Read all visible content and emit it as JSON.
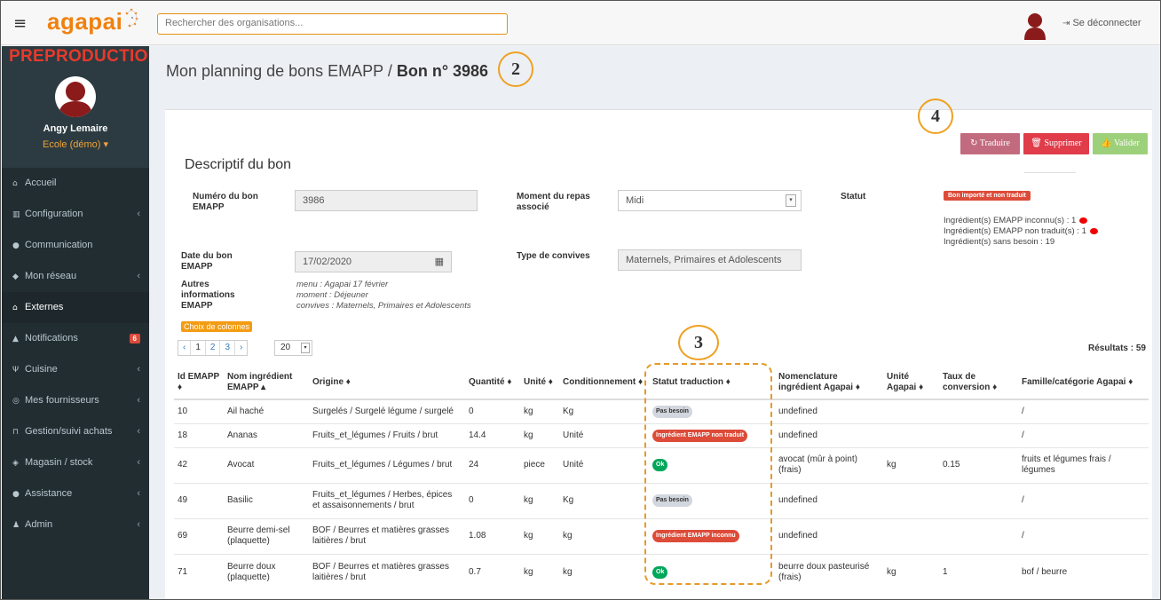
{
  "topbar": {
    "menu_icon": "hamburger-icon",
    "logo": "agapai",
    "search_placeholder": "Rechercher des organisations...",
    "logout_label": "Se déconnecter"
  },
  "sidebar": {
    "env_label": "PREPRODUCTION",
    "user_name": "Angy Lemaire",
    "user_org": "Ecole (démo) ▾",
    "items": [
      {
        "icon": "home-icon",
        "glyph": "⌂",
        "label": "Accueil",
        "arrow": ""
      },
      {
        "icon": "bank-icon",
        "glyph": "▥",
        "label": "Configuration",
        "arrow": "‹"
      },
      {
        "icon": "comments-icon",
        "glyph": "●",
        "label": "Communication",
        "arrow": ""
      },
      {
        "icon": "users-icon",
        "glyph": "◆",
        "label": "Mon réseau",
        "arrow": "‹"
      },
      {
        "icon": "home-icon",
        "glyph": "⌂",
        "label": "Externes",
        "arrow": ""
      },
      {
        "icon": "bell-icon",
        "glyph": "▲",
        "label": "Notifications",
        "arrow": "",
        "badge": "6"
      },
      {
        "icon": "cutlery-icon",
        "glyph": "Ψ",
        "label": "Cuisine",
        "arrow": "‹"
      },
      {
        "icon": "handshake-icon",
        "glyph": "◎",
        "label": "Mes fournisseurs",
        "arrow": "‹"
      },
      {
        "icon": "cart-icon",
        "glyph": "⊓",
        "label": "Gestion/suivi achats",
        "arrow": "‹"
      },
      {
        "icon": "cubes-icon",
        "glyph": "◈",
        "label": "Magasin / stock",
        "arrow": "‹"
      },
      {
        "icon": "info-icon",
        "glyph": "●",
        "label": "Assistance",
        "arrow": "‹"
      },
      {
        "icon": "user-plus-icon",
        "glyph": "♟",
        "label": "Admin",
        "arrow": "‹"
      }
    ]
  },
  "header": {
    "title_prefix": "Mon planning de bons EMAPP / ",
    "title_bold": "Bon n° 3986"
  },
  "markers": {
    "m2": "2",
    "m3": "3",
    "m4": "4"
  },
  "actions": {
    "translate": "↻ Traduire",
    "delete": "🗑 Supprimer",
    "validate": "👍 Valider"
  },
  "form": {
    "section_title": "Descriptif du bon",
    "numero_label_1": "Numéro du bon",
    "numero_label_2": "EMAPP",
    "numero_value": "3986",
    "moment_label_1": "Moment du repas",
    "moment_label_2": "associé",
    "moment_value": "Midi",
    "statut_label": "Statut",
    "statut_badge": "Bon importé et non traduit",
    "stat_line_1": "Ingrédient(s) EMAPP inconnu(s) : 1",
    "stat_line_2": "Ingrédient(s) EMAPP non traduit(s) : 1",
    "stat_line_3": "Ingrédient(s) sans besoin : 19",
    "date_label_1": "Date du bon",
    "date_label_2": "EMAPP",
    "date_value": "17/02/2020",
    "convives_label": "Type de convives",
    "convives_value": "Maternels, Primaires et Adolescents",
    "autres_label_1": "Autres",
    "autres_label_2": "informations",
    "autres_label_3": "EMAPP",
    "autres_1": "menu : Agapai 17 février",
    "autres_2": "moment : Déjeuner",
    "autres_3": "convives : Maternels, Primaires et Adolescents"
  },
  "table_controls": {
    "columns_button": "Choix de colonnes",
    "pages": [
      "‹",
      "1",
      "2",
      "3",
      "›"
    ],
    "per_page": "20",
    "results": "Résultats : 59"
  },
  "table": {
    "headers": [
      "Id EMAPP ♦",
      "Nom ingrédient EMAPP ▴",
      "Origine ♦",
      "Quantité ♦",
      "Unité ♦",
      "Conditionnement ♦",
      "Statut traduction ♦",
      "Nomenclature ingrédient Agapai ♦",
      "Unité Agapai ♦",
      "Taux de conversion ♦",
      "Famille/catégorie Agapai ♦"
    ],
    "rows": [
      {
        "id": "10",
        "nom": "Ail haché",
        "origine": "Surgelés / Surgelé légume / surgelé",
        "qte": "0",
        "unite": "kg",
        "cond": "Kg",
        "statut": "Pas besoin",
        "statut_color": "gray",
        "nomen": "undefined",
        "unite_a": "",
        "taux": "",
        "famille": "/"
      },
      {
        "id": "18",
        "nom": "Ananas",
        "origine": "Fruits_et_légumes / Fruits / brut",
        "qte": "14.4",
        "unite": "kg",
        "cond": "Unité",
        "statut": "Ingrédient EMAPP non traduit",
        "statut_color": "red",
        "nomen": "undefined",
        "unite_a": "",
        "taux": "",
        "famille": "/"
      },
      {
        "id": "42",
        "nom": "Avocat",
        "origine": "Fruits_et_légumes / Légumes / brut",
        "qte": "24",
        "unite": "piece",
        "cond": "Unité",
        "statut": "Ok",
        "statut_color": "green",
        "nomen": "avocat (mûr à point) (frais)",
        "unite_a": "kg",
        "taux": "0.15",
        "famille": "fruits et légumes frais / légumes"
      },
      {
        "id": "49",
        "nom": "Basilic",
        "origine": "Fruits_et_légumes / Herbes, épices et assaisonnements / brut",
        "qte": "0",
        "unite": "kg",
        "cond": "Kg",
        "statut": "Pas besoin",
        "statut_color": "gray",
        "nomen": "undefined",
        "unite_a": "",
        "taux": "",
        "famille": "/"
      },
      {
        "id": "69",
        "nom": "Beurre demi-sel (plaquette)",
        "origine": "BOF / Beurres et matières grasses laitières / brut",
        "qte": "1.08",
        "unite": "kg",
        "cond": "kg",
        "statut": "Ingrédient EMAPP inconnu",
        "statut_color": "red",
        "nomen": "undefined",
        "unite_a": "",
        "taux": "",
        "famille": "/"
      },
      {
        "id": "71",
        "nom": "Beurre doux (plaquette)",
        "origine": "BOF / Beurres et matières grasses laitières / brut",
        "qte": "0.7",
        "unite": "kg",
        "cond": "kg",
        "statut": "Ok",
        "statut_color": "green",
        "nomen": "beurre doux pasteurisé (frais)",
        "unite_a": "kg",
        "taux": "1",
        "famille": "bof / beurre"
      }
    ]
  }
}
